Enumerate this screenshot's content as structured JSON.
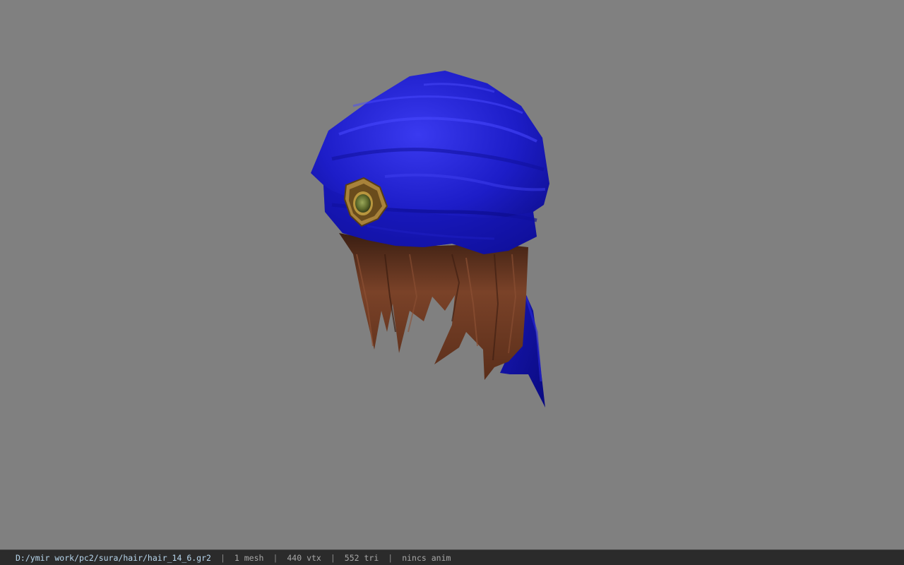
{
  "viewer": {
    "background_color": "#808080",
    "model_name": "hair_14_6",
    "colors": {
      "cloth": "#1f1fc4",
      "hair": "#6b3a22",
      "gem": "#6f7f3a",
      "gem_frame": "#b08a3a"
    }
  },
  "status": {
    "path": "D:/ymir work/pc2/sura/hair/hair_14_6.gr2",
    "separator": "|",
    "mesh": "1 mesh",
    "vertices": "440 vtx",
    "triangles": "552 tri",
    "animation": "nincs anim"
  }
}
